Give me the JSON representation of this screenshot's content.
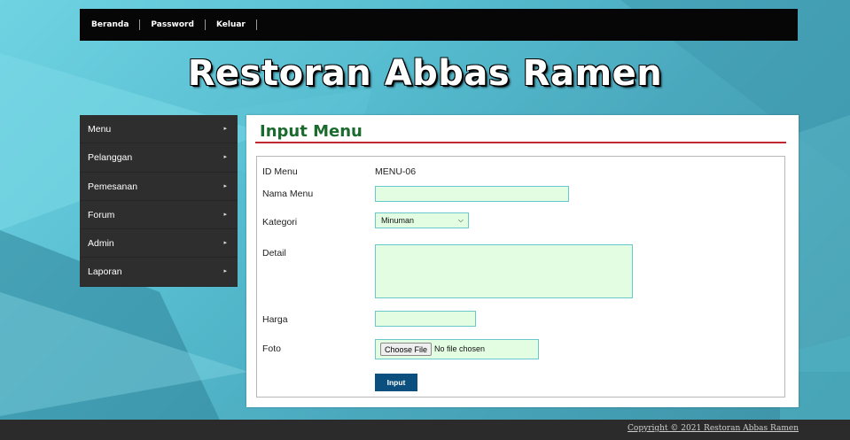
{
  "nav": {
    "items": [
      "Beranda",
      "Password",
      "Keluar"
    ]
  },
  "site_title": "Restoran Abbas Ramen",
  "sidebar": {
    "items": [
      {
        "label": "Menu",
        "arrow": "▸"
      },
      {
        "label": "Pelanggan",
        "arrow": "▸"
      },
      {
        "label": "Pemesanan",
        "arrow": "▸"
      },
      {
        "label": "Forum",
        "arrow": "▸"
      },
      {
        "label": "Admin",
        "arrow": "▸"
      },
      {
        "label": "Laporan",
        "arrow": "▸"
      }
    ]
  },
  "panel": {
    "title": "Input Menu"
  },
  "form": {
    "id_label": "ID Menu",
    "id_value": "MENU-06",
    "nama_label": "Nama Menu",
    "nama_value": "",
    "kategori_label": "Kategori",
    "kategori_value": "Minuman",
    "detail_label": "Detail",
    "detail_value": "",
    "harga_label": "Harga",
    "harga_value": "",
    "foto_label": "Foto",
    "choose_file_label": "Choose File",
    "file_status": "No file chosen",
    "submit_label": "Input"
  },
  "footer": {
    "copyright": "Copyright © 2021 Restoran Abbas Ramen"
  },
  "colors": {
    "accent_green": "#1b6b2e",
    "accent_red": "#c0282f",
    "button_blue": "#0b4f7e",
    "field_bg": "#e3fde3",
    "field_border": "#6bc7ce"
  }
}
